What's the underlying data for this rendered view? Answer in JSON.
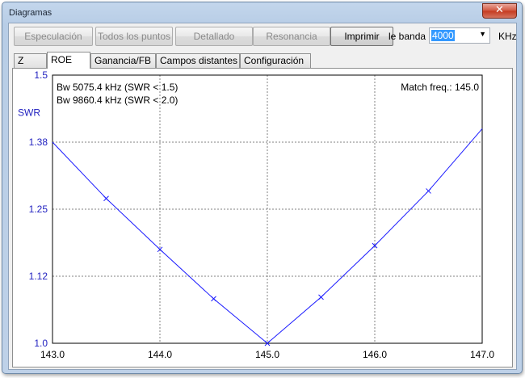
{
  "window": {
    "title": "Diagramas",
    "close_glyph": "✕"
  },
  "toolbar": {
    "buttons": [
      {
        "label": "Especulación",
        "enabled": false
      },
      {
        "label": "Todos los puntos",
        "enabled": false
      },
      {
        "label": "Detallado",
        "enabled": false
      },
      {
        "label": "Resonancia",
        "enabled": false
      },
      {
        "label": "Imprimir",
        "enabled": true
      }
    ],
    "band_label": "le banda",
    "band_value": "4000",
    "band_unit": "KHz"
  },
  "tabs": [
    {
      "label": "Z",
      "active": false
    },
    {
      "label": "ROE",
      "active": true
    },
    {
      "label": "Ganancia/FB",
      "active": false
    },
    {
      "label": "Campos distantes",
      "active": false
    },
    {
      "label": "Configuración",
      "active": false
    }
  ],
  "colors": {
    "curve": "#1a1aff",
    "axis_text": "#1f1fbf",
    "grid": "#808080"
  },
  "chart_data": {
    "type": "line",
    "ylabel": "SWR",
    "xlim": [
      143.0,
      147.0
    ],
    "ylim": [
      1.0,
      1.5
    ],
    "x_ticks": [
      "143.0",
      "144.0",
      "145.0",
      "146.0",
      "147.0"
    ],
    "y_ticks": [
      "1.5",
      "1.38",
      "1.25",
      "1.12",
      "1.0"
    ],
    "y_tick_values": [
      1.5,
      1.375,
      1.25,
      1.125,
      1.0
    ],
    "grid": true,
    "annotations": [
      "Bw 5075.4 kHz (SWR < 1.5)",
      "Bw 9860.4 kHz (SWR < 2.0)",
      "Match freq.: 145.0"
    ],
    "series": [
      {
        "x": [
          143.0,
          143.5,
          144.0,
          144.5,
          145.0,
          145.5,
          146.0,
          146.5,
          147.0
        ],
        "y": [
          1.375,
          1.27,
          1.175,
          1.083,
          1.0,
          1.086,
          1.182,
          1.284,
          1.4
        ]
      }
    ]
  }
}
